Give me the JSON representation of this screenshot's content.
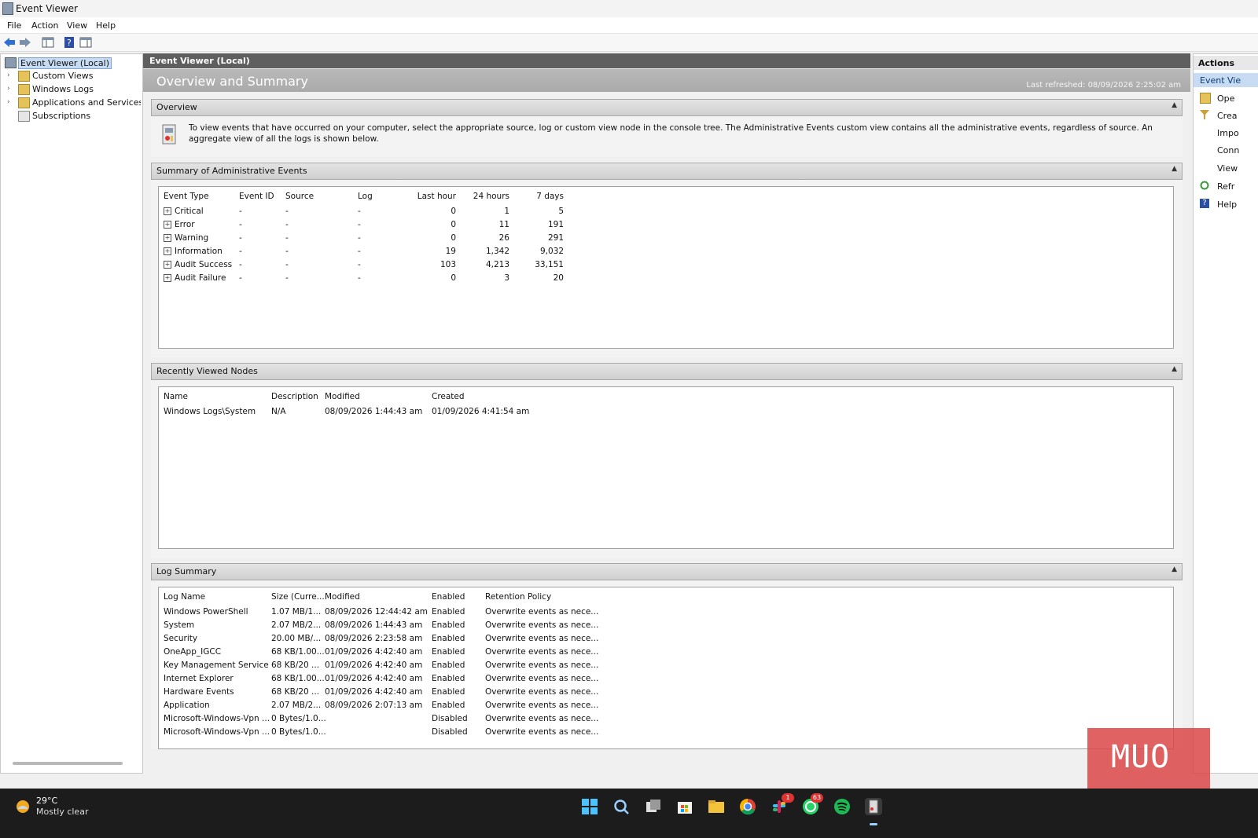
{
  "window": {
    "title": "Event Viewer"
  },
  "menu": [
    "File",
    "Action",
    "View",
    "Help"
  ],
  "tree": [
    {
      "label": "Event Viewer (Local)",
      "selected": true
    },
    {
      "label": "Custom Views"
    },
    {
      "label": "Windows Logs"
    },
    {
      "label": "Applications and Services Log"
    },
    {
      "label": "Subscriptions"
    }
  ],
  "center": {
    "header": "Event Viewer (Local)",
    "banner_title": "Overview and Summary",
    "last_refreshed": "Last refreshed: 08/09/2026 2:25:02 am"
  },
  "overview": {
    "title": "Overview",
    "text": "To view events that have occurred on your computer, select the appropriate source, log or custom view node in the console tree. The Administrative Events custom view contains all the administrative events, regardless of source. An aggregate view of all the logs is shown below."
  },
  "summary": {
    "title": "Summary of Administrative Events",
    "columns": [
      "Event Type",
      "Event ID",
      "Source",
      "Log",
      "Last hour",
      "24 hours",
      "7 days"
    ],
    "rows": [
      {
        "type": "Critical",
        "id": "-",
        "source": "-",
        "log": "-",
        "hour": "0",
        "day": "1",
        "week": "5"
      },
      {
        "type": "Error",
        "id": "-",
        "source": "-",
        "log": "-",
        "hour": "0",
        "day": "11",
        "week": "191"
      },
      {
        "type": "Warning",
        "id": "-",
        "source": "-",
        "log": "-",
        "hour": "0",
        "day": "26",
        "week": "291"
      },
      {
        "type": "Information",
        "id": "-",
        "source": "-",
        "log": "-",
        "hour": "19",
        "day": "1,342",
        "week": "9,032"
      },
      {
        "type": "Audit Success",
        "id": "-",
        "source": "-",
        "log": "-",
        "hour": "103",
        "day": "4,213",
        "week": "33,151"
      },
      {
        "type": "Audit Failure",
        "id": "-",
        "source": "-",
        "log": "-",
        "hour": "0",
        "day": "3",
        "week": "20"
      }
    ]
  },
  "recent": {
    "title": "Recently Viewed Nodes",
    "columns": [
      "Name",
      "Description",
      "Modified",
      "Created"
    ],
    "rows": [
      {
        "name": "Windows Logs\\System",
        "desc": "N/A",
        "modified": "08/09/2026 1:44:43 am",
        "created": "01/09/2026 4:41:54 am"
      }
    ]
  },
  "logsummary": {
    "title": "Log Summary",
    "columns": [
      "Log Name",
      "Size (Curre...",
      "Modified",
      "Enabled",
      "Retention Policy"
    ],
    "rows": [
      {
        "name": "Windows PowerShell",
        "size": "1.07 MB/1...",
        "modified": "08/09/2026 12:44:42 am",
        "enabled": "Enabled",
        "policy": "Overwrite events as nece..."
      },
      {
        "name": "System",
        "size": "2.07 MB/2...",
        "modified": "08/09/2026 1:44:43 am",
        "enabled": "Enabled",
        "policy": "Overwrite events as nece..."
      },
      {
        "name": "Security",
        "size": "20.00 MB/...",
        "modified": "08/09/2026 2:23:58 am",
        "enabled": "Enabled",
        "policy": "Overwrite events as nece..."
      },
      {
        "name": "OneApp_IGCC",
        "size": "68 KB/1.00...",
        "modified": "01/09/2026 4:42:40 am",
        "enabled": "Enabled",
        "policy": "Overwrite events as nece..."
      },
      {
        "name": "Key Management Service",
        "size": "68 KB/20 ...",
        "modified": "01/09/2026 4:42:40 am",
        "enabled": "Enabled",
        "policy": "Overwrite events as nece..."
      },
      {
        "name": "Internet Explorer",
        "size": "68 KB/1.00...",
        "modified": "01/09/2026 4:42:40 am",
        "enabled": "Enabled",
        "policy": "Overwrite events as nece..."
      },
      {
        "name": "Hardware Events",
        "size": "68 KB/20 ...",
        "modified": "01/09/2026 4:42:40 am",
        "enabled": "Enabled",
        "policy": "Overwrite events as nece..."
      },
      {
        "name": "Application",
        "size": "2.07 MB/2...",
        "modified": "08/09/2026 2:07:13 am",
        "enabled": "Enabled",
        "policy": "Overwrite events as nece..."
      },
      {
        "name": "Microsoft-Windows-Vpn ...",
        "size": "0 Bytes/1.0...",
        "modified": "",
        "enabled": "Disabled",
        "policy": "Overwrite events as nece..."
      },
      {
        "name": "Microsoft-Windows-Vpn ...",
        "size": "0 Bytes/1.0...",
        "modified": "",
        "enabled": "Disabled",
        "policy": "Overwrite events as nece..."
      }
    ]
  },
  "actions": {
    "title": "Actions",
    "subheader": "Event Vie",
    "items": [
      "Ope",
      "Crea",
      "Impo",
      "Conn",
      "View",
      "Refr",
      "Help"
    ]
  },
  "taskbar": {
    "weather_temp": "29°C",
    "weather_desc": "Mostly clear",
    "badges": [
      "1",
      "63"
    ]
  },
  "watermark": "MUO",
  "colors": {
    "selection": "#c7dcf2",
    "header_dark": "#5f5f5f",
    "banner": "#b1b1b1"
  }
}
